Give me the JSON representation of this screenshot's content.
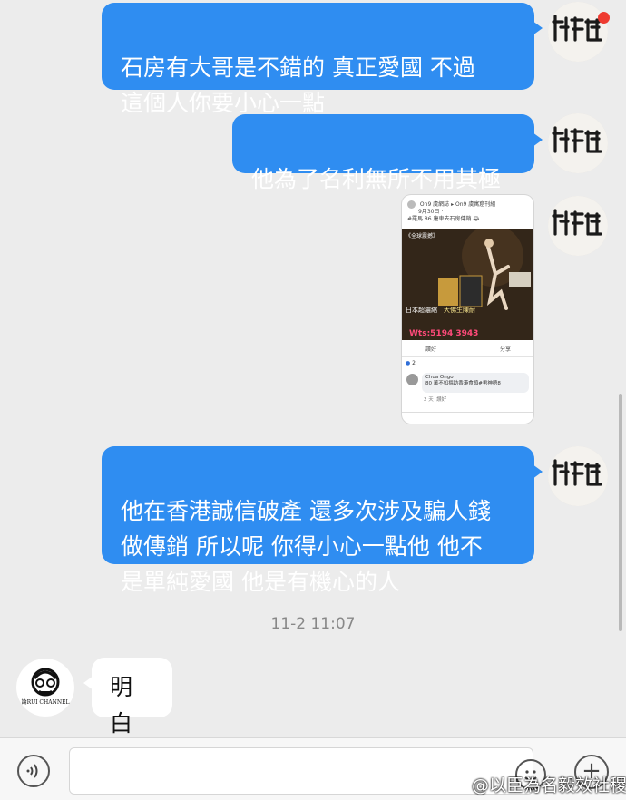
{
  "messages": {
    "m1": "石房有大哥是不錯的 真正愛國 不過\n這個人你要小心一點",
    "m2": "他為了名利無所不用其極",
    "m4": "他在香港誠信破產 還多次涉及騙人錢\n做傳銷 所以呢 你得小心一點他 他不\n是單純愛國 他是有機心的人",
    "reply": "明白"
  },
  "timestamp": "11-2 11:07",
  "shared_post": {
    "header_line1": "On9 虞網誌 ▸ On9 虞寓窟刊組",
    "header_line2": "9月30日 ·",
    "caption": "#羅馬 86 唐車去石房傳銷 😂",
    "banner_tag": "《全球震撼》",
    "banner_text1": "日本超濃縮",
    "banner_text2": "大佛生陳耐",
    "banner_phone": "Wts:5194 3943",
    "like_label": "讚好",
    "share_label": "分享",
    "reactions_count": "2",
    "commenter": "Chua Ongo",
    "comment_text": "80 萬不如搵助香港食頭#男神唔8",
    "comment_time": "2 天",
    "comment_like": "讚好"
  },
  "input_bar": {
    "plus_symbol": "+"
  },
  "watermark": "@以臣為名毅效社稷",
  "avatars": {
    "contact_brand": "論RUI CHANNEL"
  },
  "colors": {
    "outgoing_bubble": "#2f8df1",
    "incoming_bubble": "#ffffff",
    "background": "#ececec",
    "notification": "#ee3b30"
  }
}
